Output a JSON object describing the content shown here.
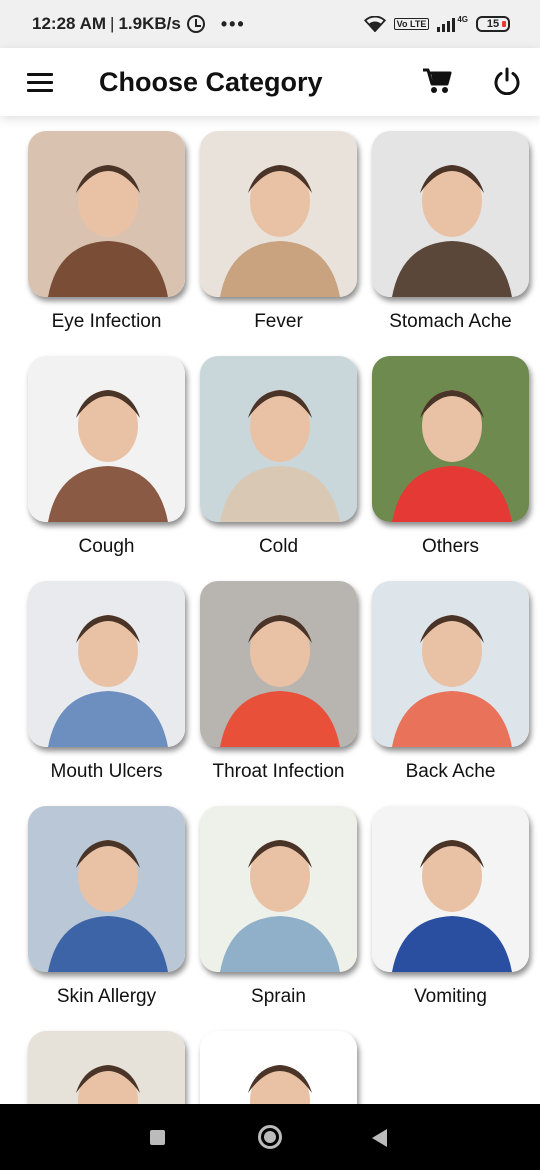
{
  "status_bar": {
    "time": "12:28 AM",
    "separator": "|",
    "speed": "1.9KB/s",
    "dots": "•••",
    "volte": "Vo LTE",
    "network": "4G",
    "battery": "15"
  },
  "app_bar": {
    "title": "Choose Category",
    "menu_icon": "hamburger-menu-icon",
    "cart_icon": "shopping-cart-icon",
    "power_icon": "power-icon"
  },
  "categories": [
    {
      "label": "Eye Infection",
      "bg": "#d9c2b0",
      "accent": "#7a4e36"
    },
    {
      "label": "Fever",
      "bg": "#e8e2da",
      "accent": "#c9a27f"
    },
    {
      "label": "Stomach Ache",
      "bg": "#e4e4e4",
      "accent": "#5b463a"
    },
    {
      "label": "Cough",
      "bg": "#f2f2f2",
      "accent": "#8a5a44"
    },
    {
      "label": "Cold",
      "bg": "#c9d6da",
      "accent": "#d8c8b4"
    },
    {
      "label": "Others",
      "bg": "#6e8a4e",
      "accent": "#e53935"
    },
    {
      "label": "Mouth Ulcers",
      "bg": "#e8eaee",
      "accent": "#6c8fbf"
    },
    {
      "label": "Throat Infection",
      "bg": "#b8b4b0",
      "accent": "#e8503a"
    },
    {
      "label": "Back Ache",
      "bg": "#dde4ea",
      "accent": "#e8735a"
    },
    {
      "label": "Skin Allergy",
      "bg": "#b9c7d6",
      "accent": "#3e64a8"
    },
    {
      "label": "Sprain",
      "bg": "#eef0ea",
      "accent": "#8fb0c8"
    },
    {
      "label": "Vomiting",
      "bg": "#f4f4f4",
      "accent": "#2a4fa0"
    },
    {
      "label": "",
      "bg": "#e6e2da",
      "accent": "#d9b486"
    },
    {
      "label": "",
      "bg": "#ffffff",
      "accent": "#b87a5c"
    }
  ],
  "nav_bar": {
    "recents_icon": "recents-square-icon",
    "home_icon": "home-circle-icon",
    "back_icon": "back-triangle-icon"
  }
}
